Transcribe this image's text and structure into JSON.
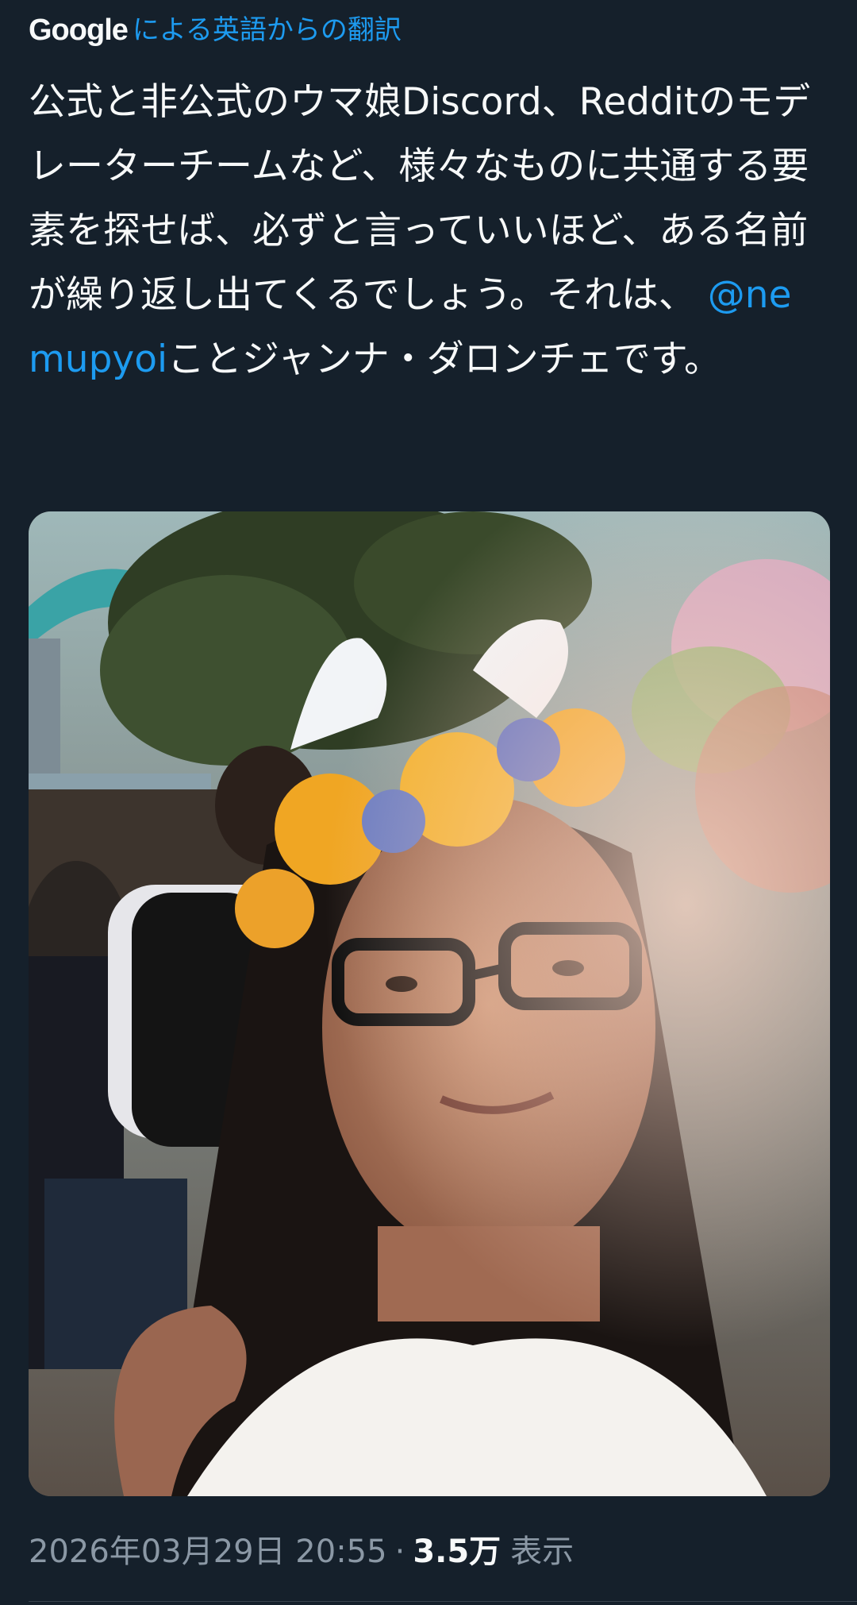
{
  "translation": {
    "provider": "Google",
    "label": "による英語からの翻訳"
  },
  "tweet": {
    "text_before": "公式と非公式のウマ娘Discord、Redditのモデレーターチームなど、様々なものに共通する要素を探せば、必ずと言っていいほど、ある名前が繰り返し出てくるでしょう。それは、 ",
    "mention": "@nemupyoi",
    "text_after": "ことジャンナ・ダロンチェです。"
  },
  "meta": {
    "timestamp": "2026年03月29日 20:55",
    "separator": "·",
    "views_count": "3.5万",
    "views_label": "表示"
  },
  "colors": {
    "background": "#15202b",
    "link": "#1d9bf0",
    "secondary_text": "#8b98a5"
  }
}
